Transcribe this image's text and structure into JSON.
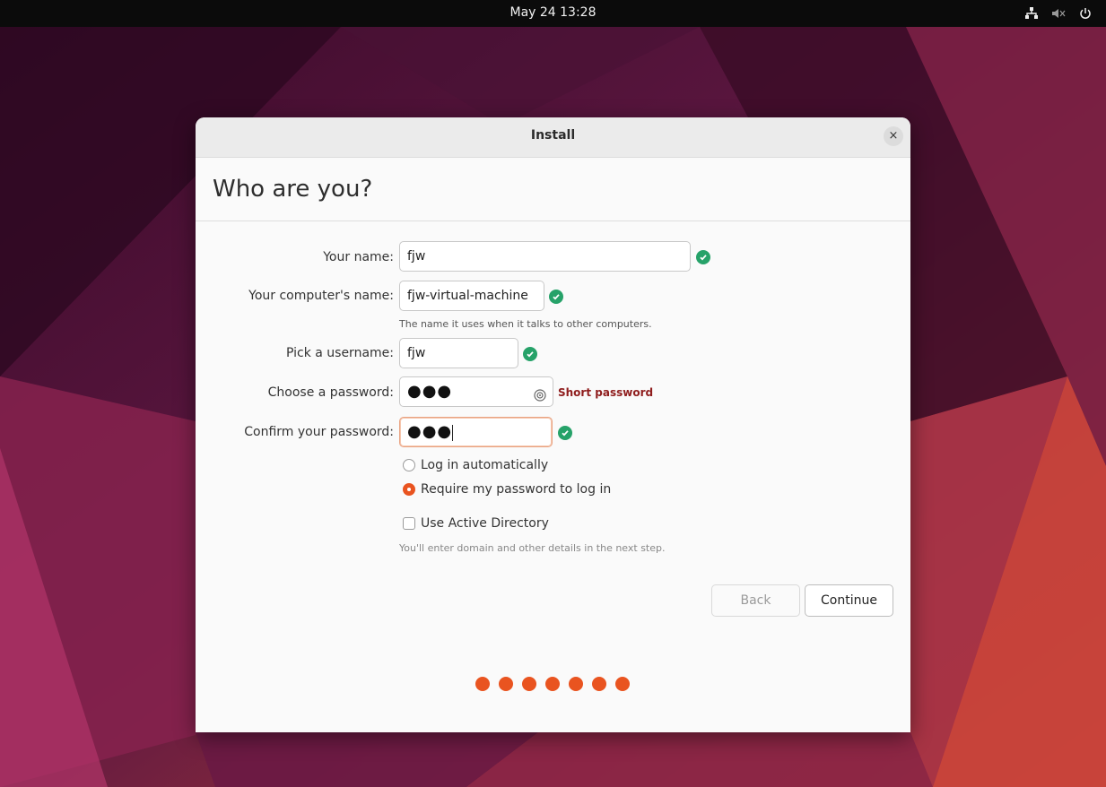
{
  "topbar": {
    "clock": "May 24  13:28",
    "tray_icons": [
      "network-icon",
      "volume-muted-icon",
      "power-icon"
    ]
  },
  "window": {
    "title": "Install",
    "close_label": "×",
    "heading": "Who are you?"
  },
  "form": {
    "name_label": "Your name:",
    "name_value": "fjw",
    "computer_label": "Your computer's name:",
    "computer_value": "fjw-virtual-machine",
    "computer_hint": "The name it uses when it talks to other computers.",
    "username_label": "Pick a username:",
    "username_value": "fjw",
    "password_label": "Choose a password:",
    "password_value": "●●●",
    "password_strength": "Short password",
    "confirm_label": "Confirm your password:",
    "confirm_value": "●●●",
    "login_auto_label": "Log in automatically",
    "login_require_label": "Require my password to log in",
    "login_selected": "require",
    "active_directory_label": "Use Active Directory",
    "active_directory_checked": false,
    "active_directory_hint": "You'll enter domain and other details in the next step."
  },
  "buttons": {
    "back": "Back",
    "continue": "Continue"
  },
  "progress": {
    "steps": 7,
    "color": "#e95420"
  },
  "colors": {
    "accent": "#e95420",
    "valid": "#26a269",
    "warning_text": "#8f1d1d"
  }
}
